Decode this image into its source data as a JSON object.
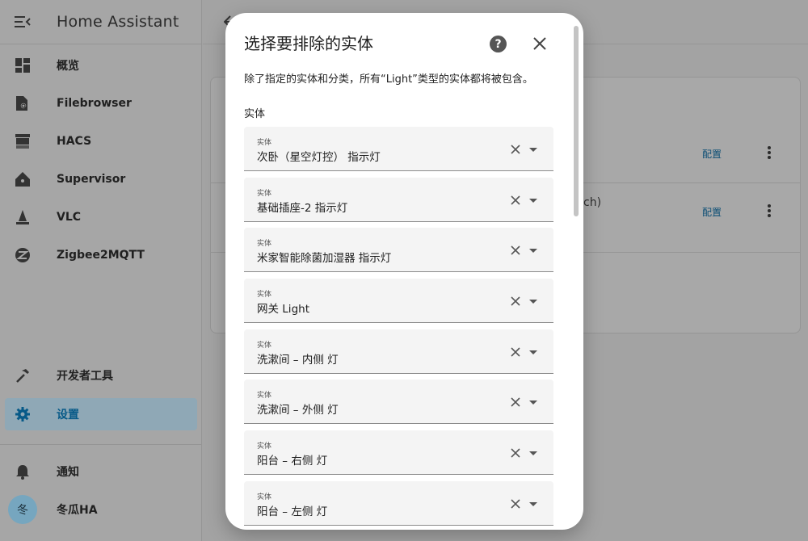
{
  "sidebar": {
    "title": "Home Assistant",
    "items": [
      {
        "label": "概览",
        "icon": "dashboard-icon"
      },
      {
        "label": "Filebrowser",
        "icon": "file-search-icon"
      },
      {
        "label": "HACS",
        "icon": "hacs-store-icon"
      },
      {
        "label": "Supervisor",
        "icon": "home-assistant-icon"
      },
      {
        "label": "VLC",
        "icon": "vlc-cone-icon"
      },
      {
        "label": "Zigbee2MQTT",
        "icon": "zigbee-icon"
      }
    ],
    "developer_tools": "开发者工具",
    "settings": "设置",
    "notifications": "通知",
    "user": {
      "name": "冬瓜HA",
      "initial": "冬"
    }
  },
  "background": {
    "rows": [
      {
        "link": "配置"
      },
      {
        "text_fragment": "ch)",
        "link": "配置"
      }
    ]
  },
  "dialog": {
    "title": "选择要排除的实体",
    "description": "除了指定的实体和分类，所有“Light”类型的实体都将被包含。",
    "section_label": "实体",
    "fields": [
      {
        "label": "实体",
        "value": "次卧（星空灯控） 指示灯"
      },
      {
        "label": "实体",
        "value": "基础插座-2 指示灯"
      },
      {
        "label": "实体",
        "value": "米家智能除菌加湿器 指示灯"
      },
      {
        "label": "实体",
        "value": "网关 Light"
      },
      {
        "label": "实体",
        "value": "洗漱间 – 内侧 灯"
      },
      {
        "label": "实体",
        "value": "洗漱间 – 外侧 灯"
      },
      {
        "label": "实体",
        "value": "阳台 – 右侧 灯"
      },
      {
        "label": "实体",
        "value": "阳台 – 左侧 灯"
      }
    ]
  }
}
